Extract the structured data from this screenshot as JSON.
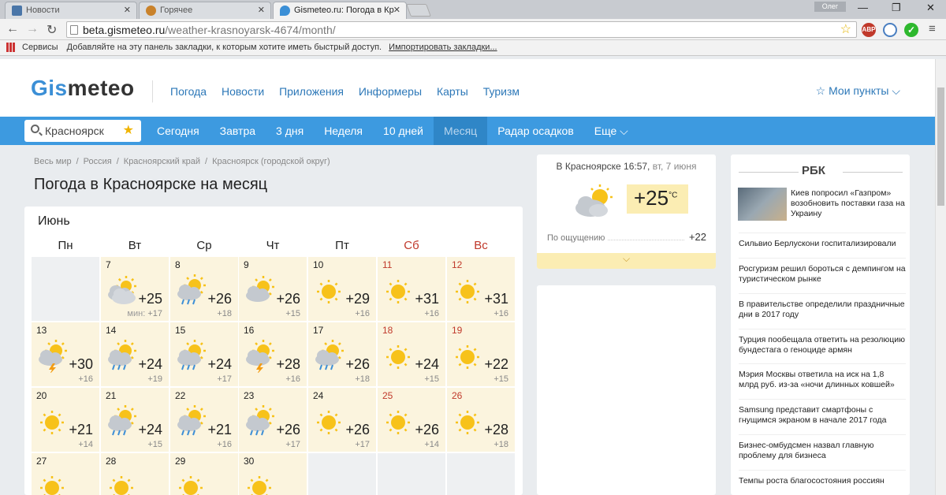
{
  "browser": {
    "tabs": [
      {
        "label": "Новости",
        "favicon_color": "#4a76a8"
      },
      {
        "label": "Горячее",
        "favicon_color": "#c9822b"
      },
      {
        "label": "Gismeteo.ru: Погода в Кр",
        "favicon_color": "#3b8fd6"
      }
    ],
    "user": "Олег",
    "url_host": "beta.gismeteo.ru",
    "url_path": "/weather-krasnoyarsk-4674/month/",
    "bookmarks": {
      "apps_label": "Сервисы",
      "hint": "Добавляйте на эту панель закладки, к которым хотите иметь быстрый доступ.",
      "import_link": "Импортировать закладки..."
    }
  },
  "site": {
    "logo_gis": "Gis",
    "logo_meteo": "meteo",
    "top_nav": [
      "Погода",
      "Новости",
      "Приложения",
      "Информеры",
      "Карты",
      "Туризм"
    ],
    "my_points": "☆ Мои пункты ⌵",
    "search_value": "Красноярск",
    "period_nav": [
      "Сегодня",
      "Завтра",
      "3 дня",
      "Неделя",
      "10 дней",
      "Месяц",
      "Радар осадков",
      "Еще ⌵"
    ],
    "period_selected": "Месяц",
    "breadcrumbs": [
      "Весь мир",
      "Россия",
      "Красноярский край",
      "Красноярск (городской округ)"
    ],
    "page_title": "Погода в Красноярске на месяц"
  },
  "calendar": {
    "month": "Июнь",
    "weekdays": [
      "Пн",
      "Вт",
      "Ср",
      "Чт",
      "Пт",
      "Сб",
      "Вс"
    ],
    "min_label": "мин:",
    "days": [
      {
        "d": "7",
        "hi": "+25",
        "lo": "+17",
        "icon": "partly-cloudy-icon"
      },
      {
        "d": "8",
        "hi": "+26",
        "lo": "+18",
        "icon": "sun-cloud-rain-icon"
      },
      {
        "d": "9",
        "hi": "+26",
        "lo": "+15",
        "icon": "sun-cloud-icon"
      },
      {
        "d": "10",
        "hi": "+29",
        "lo": "+16",
        "icon": "sun-icon"
      },
      {
        "d": "11",
        "hi": "+31",
        "lo": "+16",
        "icon": "sun-icon"
      },
      {
        "d": "12",
        "hi": "+31",
        "lo": "+16",
        "icon": "sun-icon"
      },
      {
        "d": "13",
        "hi": "+30",
        "lo": "+16",
        "icon": "thunderstorm-icon"
      },
      {
        "d": "14",
        "hi": "+24",
        "lo": "+19",
        "icon": "sun-cloud-rain-icon"
      },
      {
        "d": "15",
        "hi": "+24",
        "lo": "+17",
        "icon": "sun-cloud-rain-icon"
      },
      {
        "d": "16",
        "hi": "+28",
        "lo": "+16",
        "icon": "thunderstorm-icon"
      },
      {
        "d": "17",
        "hi": "+26",
        "lo": "+18",
        "icon": "sun-cloud-rain-icon"
      },
      {
        "d": "18",
        "hi": "+24",
        "lo": "+15",
        "icon": "sun-icon"
      },
      {
        "d": "19",
        "hi": "+22",
        "lo": "+15",
        "icon": "sun-icon"
      },
      {
        "d": "20",
        "hi": "+21",
        "lo": "+14",
        "icon": "sun-icon"
      },
      {
        "d": "21",
        "hi": "+24",
        "lo": "+15",
        "icon": "sun-cloud-rain-icon"
      },
      {
        "d": "22",
        "hi": "+21",
        "lo": "+16",
        "icon": "sun-cloud-rain-icon"
      },
      {
        "d": "23",
        "hi": "+26",
        "lo": "+17",
        "icon": "sun-cloud-rain-icon"
      },
      {
        "d": "24",
        "hi": "+26",
        "lo": "+17",
        "icon": "sun-icon"
      },
      {
        "d": "25",
        "hi": "+26",
        "lo": "+14",
        "icon": "sun-icon"
      },
      {
        "d": "26",
        "hi": "+28",
        "lo": "+18",
        "icon": "sun-icon"
      },
      {
        "d": "27",
        "hi": "",
        "lo": "",
        "icon": "sun-icon"
      },
      {
        "d": "28",
        "hi": "",
        "lo": "",
        "icon": "sun-icon"
      },
      {
        "d": "29",
        "hi": "",
        "lo": "",
        "icon": "sun-icon"
      },
      {
        "d": "30",
        "hi": "",
        "lo": "",
        "icon": "sun-icon"
      }
    ]
  },
  "now": {
    "location": "В Красноярске 16:57,",
    "date": "вт, 7 июня",
    "temp": "+25",
    "unit": "°C",
    "feels_label": "По ощущению",
    "feels_value": "+22",
    "expand": "⌵"
  },
  "news": {
    "source": "РБК",
    "items": [
      "Киев попросил «Газпром» возобновить поставки газа на Украину",
      "Сильвио Берлускони госпитализировали",
      "Росгуризм решил бороться с демпингом на туристическом рынке",
      "В правительстве определили праздничные дни в 2017 году",
      "Турция пообещала ответить на резолюцию бундестага о геноциде армян",
      "Мэрия Москвы ответила на иск на 1,8 млрд руб. из-за «ночи длинных ковшей»",
      "Samsung представит смартфоны с гнущимся экраном в начале 2017 года",
      "Бизнес-омбудсмен назвал главную проблему для бизнеса",
      "Темпы роста благосостояния россиян"
    ]
  }
}
